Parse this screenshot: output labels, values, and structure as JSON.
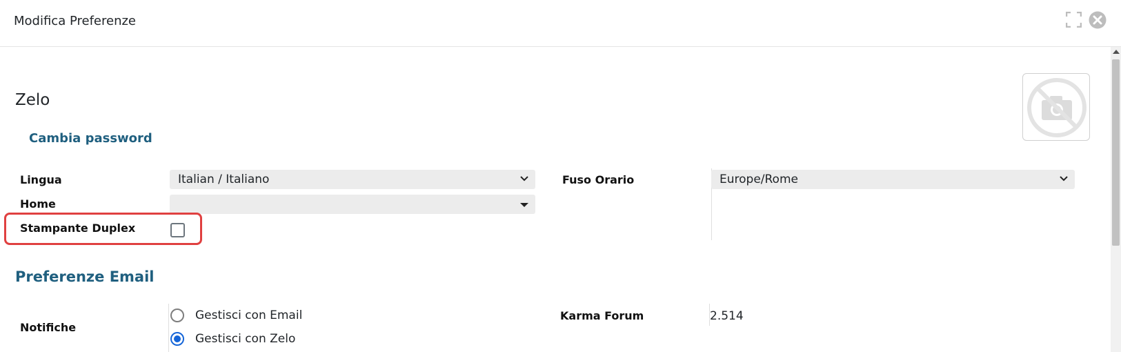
{
  "modal": {
    "title": "Modifica Preferenze"
  },
  "user": {
    "name": "Zelo",
    "change_password": "Cambia password"
  },
  "preferences": {
    "language_label": "Lingua",
    "language_value": "Italian / Italiano",
    "home_label": "Home",
    "home_value": "",
    "duplex_label": "Stampante Duplex",
    "duplex_checked": false,
    "timezone_label": "Fuso Orario",
    "timezone_value": "Europe/Rome"
  },
  "email_preferences": {
    "section_title": "Preferenze Email",
    "notifications_label": "Notifiche",
    "options": [
      {
        "label": "Gestisci con Email",
        "checked": false
      },
      {
        "label": "Gestisci con Zelo",
        "checked": true
      }
    ],
    "karma_label": "Karma Forum",
    "karma_value": "2.514"
  },
  "colors": {
    "accent": "#1f5f7f",
    "highlight": "#e04040",
    "radio_selected": "#1565d8"
  }
}
